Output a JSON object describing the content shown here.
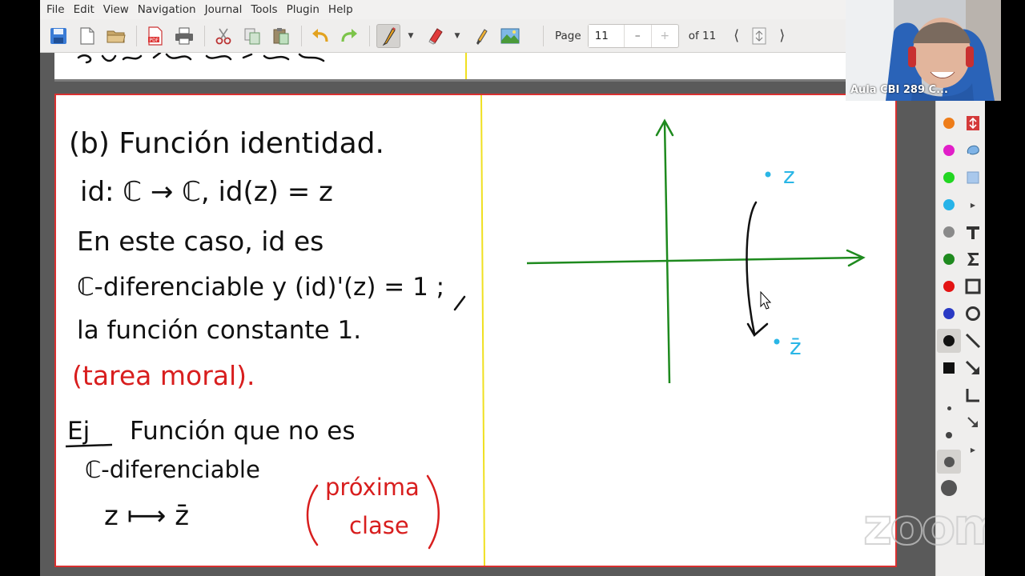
{
  "menu": [
    "File",
    "Edit",
    "View",
    "Navigation",
    "Journal",
    "Tools",
    "Plugin",
    "Help"
  ],
  "toolbar": {
    "page_label": "Page",
    "page_value": "11",
    "page_minus": "–",
    "page_plus": "+",
    "page_of": "of 11",
    "icons": [
      "save-icon",
      "new-page-icon",
      "open-folder-icon",
      "export-pdf-icon",
      "print-icon",
      "cut-icon",
      "copy-icon",
      "paste-icon",
      "undo-icon",
      "redo-icon",
      "pen-icon",
      "eraser-icon",
      "highlighter-icon",
      "image-icon"
    ]
  },
  "video": {
    "participant_name": "Aula CBI 289 C..."
  },
  "watermark": "zoom",
  "palette": {
    "colors": [
      "#ee7d1a",
      "#e11ec8",
      "#22d622",
      "#27b3e8",
      "#8a8a8a",
      "#1f8a1f",
      "#e31414",
      "#2a3ac4",
      "#111111"
    ]
  },
  "note": {
    "lines": [
      "(b) Función identidad.",
      "id: ℂ → ℂ,   id(z) = z",
      "En este caso, id es",
      "ℂ-diferenciable y (id)'(z) = 1 ;",
      "la función constante 1.",
      "(tarea moral).",
      "Ej",
      "Función que no es",
      "ℂ-diferenciable",
      "z ⟼ z̄",
      "próxima",
      "clase"
    ],
    "diagram_labels": {
      "point_z": "z",
      "point_zbar": "z̄"
    }
  },
  "colors": {
    "ink": "#111111",
    "red": "#d81e1e",
    "green": "#1e8a1e",
    "cyan": "#2ab6e6",
    "page_border": "#d93030",
    "margin_line": "#f0e020"
  }
}
